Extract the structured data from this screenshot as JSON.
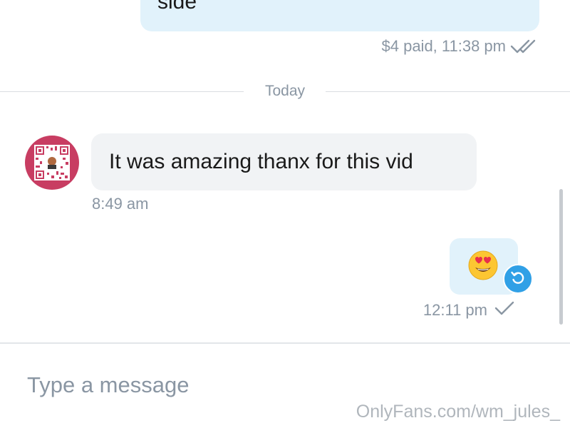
{
  "messages": [
    {
      "direction": "outgoing",
      "text": "side",
      "meta": "$4 paid, 11:38 pm",
      "status_icon": "double-check-icon"
    },
    {
      "direction": "incoming",
      "text": "It was amazing thanx for this vid",
      "time": "8:49 am",
      "avatar_icon": "qr-code-avatar"
    },
    {
      "direction": "outgoing",
      "emoji": "😍",
      "emoji_name": "heart-eyes-emoji",
      "time": "12:11 pm",
      "status_icon": "single-check-icon",
      "action_icon": "undo-icon"
    }
  ],
  "divider": {
    "label": "Today"
  },
  "composer": {
    "placeholder": "Type a message"
  },
  "watermark": "OnlyFans.com/wm_jules_",
  "colors": {
    "outgoing_bubble": "#e1f2fb",
    "incoming_bubble": "#f1f3f5",
    "meta_text": "#8a96a3",
    "accent": "#30a0e6",
    "avatar_bg": "#c83d62"
  }
}
